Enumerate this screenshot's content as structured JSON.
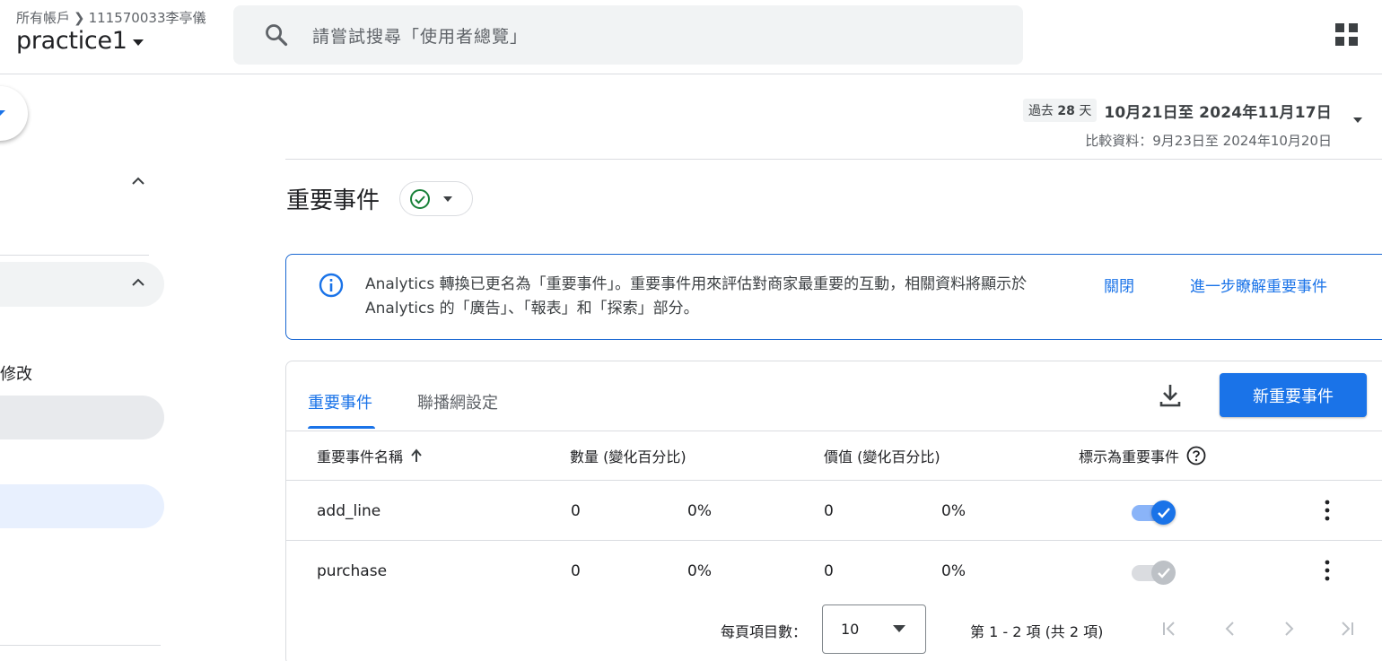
{
  "header": {
    "breadcrumb_root": "所有帳戶",
    "breadcrumb_account": "111570033李亭儀",
    "property_name": "practice1",
    "search_placeholder": "請嘗試搜尋「使用者總覽」"
  },
  "sidebar": {
    "partial_label": "修改"
  },
  "date_range": {
    "preset_prefix": "過去",
    "preset_number": "28",
    "preset_suffix": "天",
    "main": "10月21日至 2024年11月17日",
    "compare": "比較資料：9月23日至 2024年10月20日"
  },
  "page": {
    "title": "重要事件"
  },
  "banner": {
    "message": "Analytics 轉換已更名為「重要事件」。重要事件用來評估對商家最重要的互動，相關資料將顯示於 Analytics 的「廣告」、「報表」和「探索」部分。",
    "close_label": "關閉",
    "learn_more_label": "進一步瞭解重要事件"
  },
  "tabs": [
    {
      "label": "重要事件",
      "active": true
    },
    {
      "label": "聯播網設定",
      "active": false
    }
  ],
  "actions": {
    "new_button_label": "新重要事件"
  },
  "table": {
    "headers": {
      "name": "重要事件名稱",
      "count": "數量 (變化百分比)",
      "value": "價值 (變化百分比)",
      "mark": "標示為重要事件"
    },
    "rows": [
      {
        "name": "add_line",
        "count": "0",
        "count_pct": "0%",
        "value": "0",
        "value_pct": "0%",
        "marked": true,
        "editable": true
      },
      {
        "name": "purchase",
        "count": "0",
        "count_pct": "0%",
        "value": "0",
        "value_pct": "0%",
        "marked": true,
        "editable": false
      }
    ]
  },
  "pagination": {
    "per_page_label": "每頁項目數：",
    "per_page_value": "10",
    "range_text": "第 1 - 2 項 (共 2 項)"
  },
  "colors": {
    "accent": "#1a73e8",
    "success": "#188038",
    "text": "#202124",
    "muted": "#5f6368"
  },
  "icons": [
    "search-icon",
    "apps-grid-icon",
    "check-circle-icon",
    "info-icon",
    "download-icon",
    "arrow-up-icon",
    "help-icon",
    "more-vert-icon",
    "first-page-icon",
    "prev-page-icon",
    "next-page-icon",
    "last-page-icon"
  ]
}
